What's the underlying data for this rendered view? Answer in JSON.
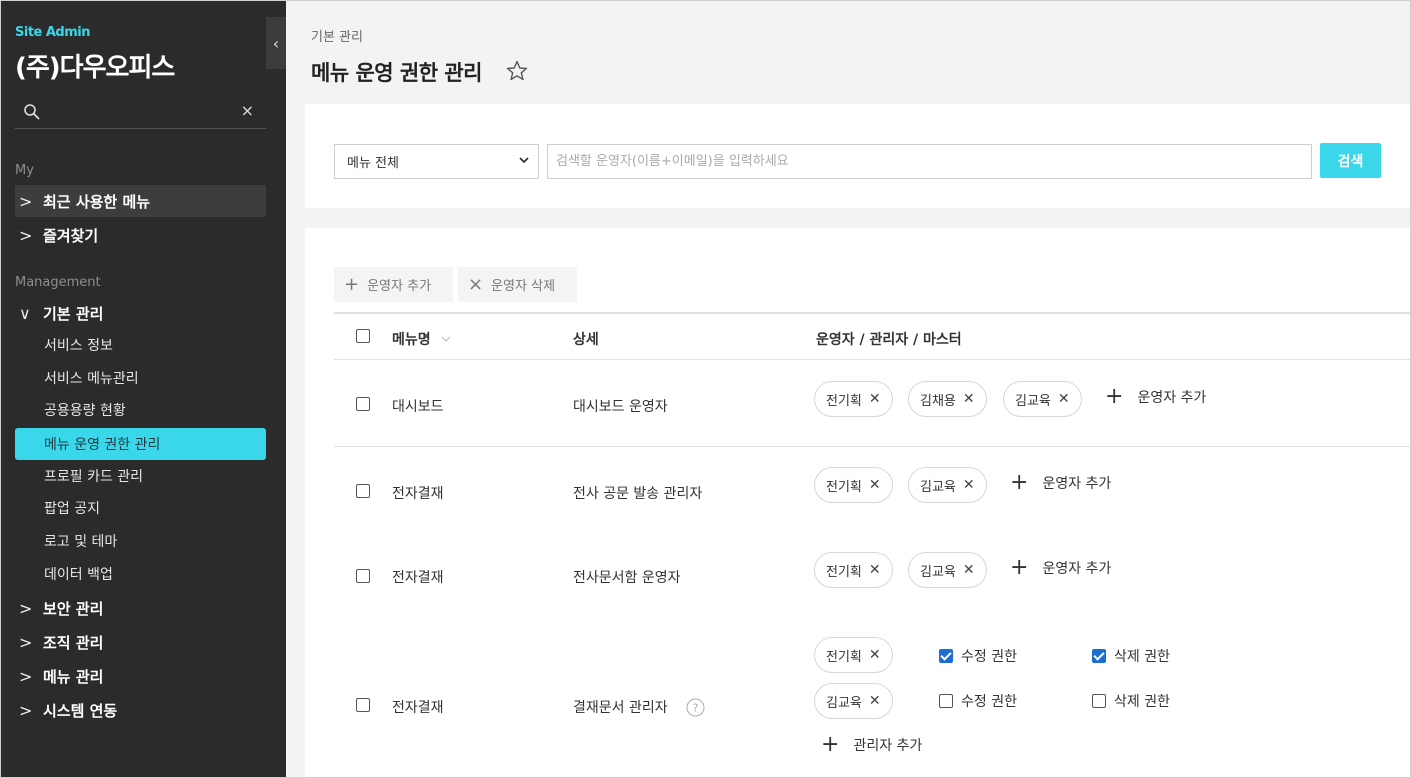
{
  "sidebar": {
    "tag": "Site Admin",
    "company": "(주)다우오피스",
    "collapse_glyph": "‹",
    "search_placeholder": "",
    "clear_glyph": "×",
    "my_label": "My",
    "my_items": [
      {
        "label": "최근 사용한 메뉴"
      },
      {
        "label": "즐겨찾기"
      }
    ],
    "management_label": "Management",
    "basic_group": "기본 관리",
    "basic_items": [
      {
        "label": "서비스 정보"
      },
      {
        "label": "서비스 메뉴관리"
      },
      {
        "label": "공용용량 현황"
      },
      {
        "label": "메뉴 운영 권한 관리"
      },
      {
        "label": "프로필 카드 관리"
      },
      {
        "label": "팝업 공지"
      },
      {
        "label": "로고 및 테마"
      },
      {
        "label": "데이터 백업"
      }
    ],
    "other_groups": [
      {
        "label": "보안 관리"
      },
      {
        "label": "조직 관리"
      },
      {
        "label": "메뉴 관리"
      },
      {
        "label": "시스템 연동"
      }
    ]
  },
  "header": {
    "breadcrumb": "기본 관리",
    "title": "메뉴 운영 권한 관리"
  },
  "search": {
    "select_value": "메뉴 전체",
    "placeholder": "검색할 운영자(이름+이메일)을 입력하세요",
    "button": "검색"
  },
  "toolbar": {
    "add": "운영자 추가",
    "delete": "운영자 삭제"
  },
  "table": {
    "col_menu": "메뉴명",
    "col_detail": "상세",
    "col_ops": "운영자 / 관리자 / 마스터",
    "add_operator": "운영자 추가",
    "add_manager": "관리자 추가",
    "rows": [
      {
        "menu": "대시보드",
        "detail": "대시보드 운영자",
        "chips": [
          "전기획",
          "김채용",
          "김교육"
        ]
      },
      {
        "menu": "전자결재",
        "detail": "전사 공문 발송 관리자",
        "chips": [
          "전기획",
          "김교육"
        ]
      },
      {
        "menu": "전자결재",
        "detail": "전사문서함 운영자",
        "chips": [
          "전기획",
          "김교육"
        ]
      },
      {
        "menu": "전자결재",
        "detail": "결재문서 관리자",
        "managers": [
          {
            "name": "전기획",
            "edit_label": "수정 권한",
            "edit": true,
            "delete_label": "삭제 권한",
            "delete": true
          },
          {
            "name": "김교육",
            "edit_label": "수정 권한",
            "edit": false,
            "delete_label": "삭제 권한",
            "delete": false
          }
        ]
      }
    ]
  },
  "colors": {
    "accent": "#3ad7eb",
    "sidebar": "#2b2b2b",
    "check": "#1c6fd1"
  }
}
